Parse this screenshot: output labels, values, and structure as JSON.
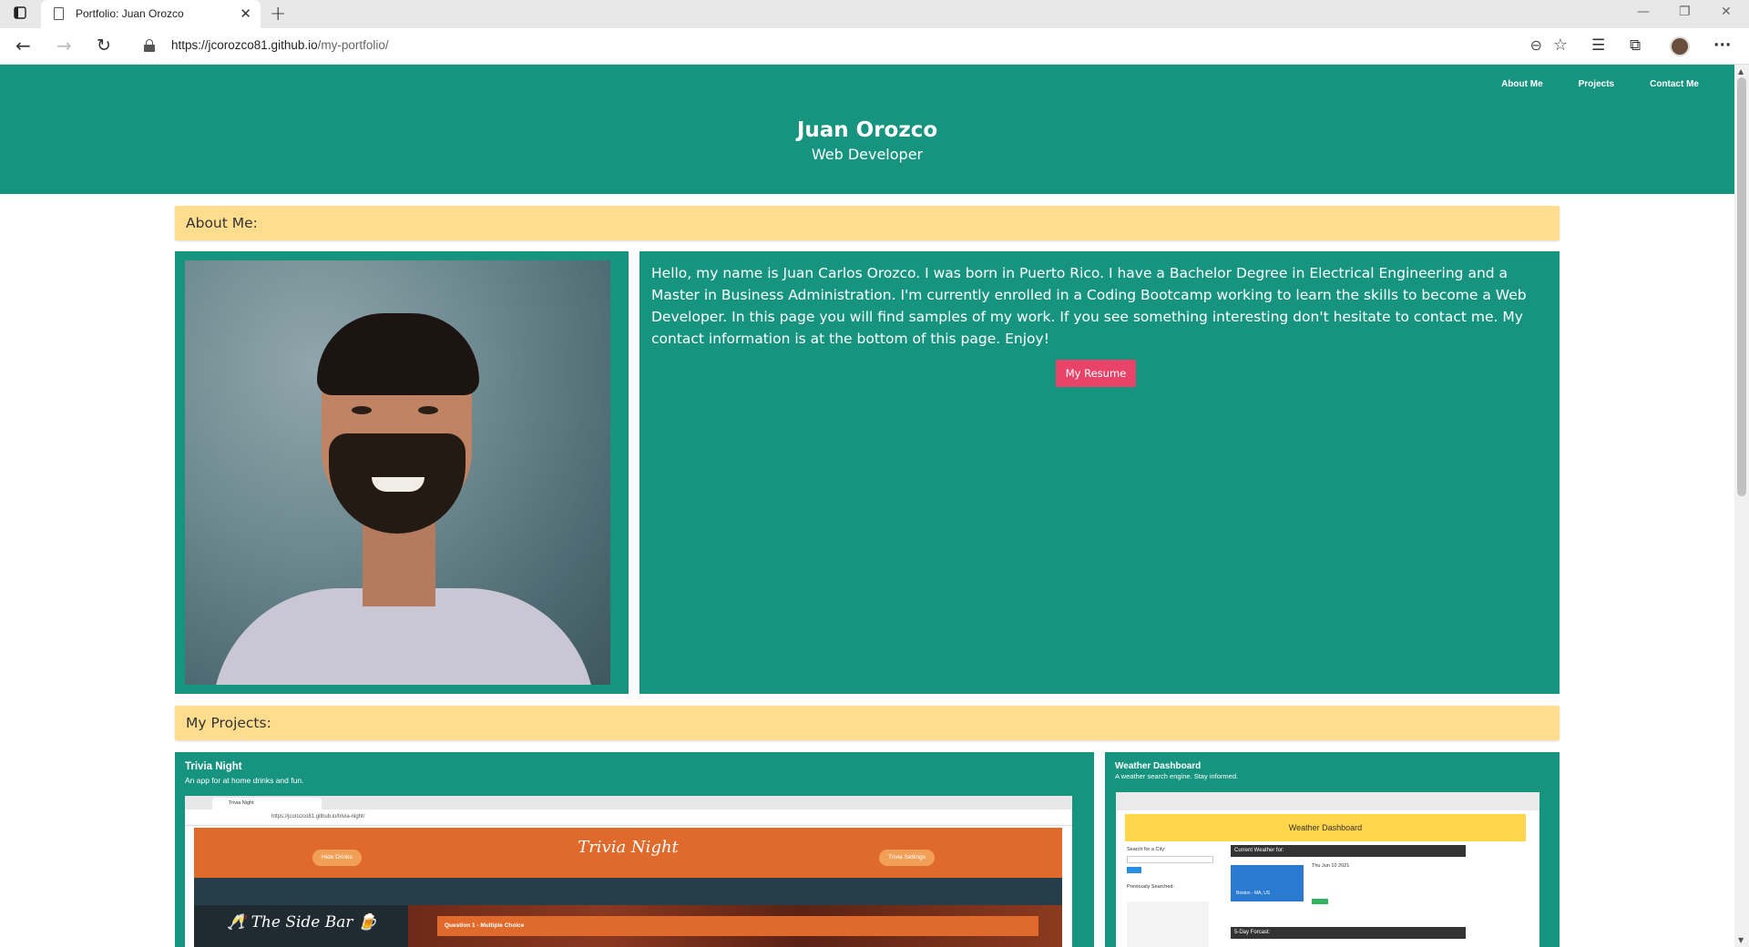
{
  "browser": {
    "tab_title": "Portfolio: Juan Orozco",
    "url_host": "https://jcorozco81.github.io",
    "url_path": "/my-portfolio/"
  },
  "header": {
    "name": "Juan Orozco",
    "role": "Web Developer",
    "nav": [
      "About Me",
      "Projects",
      "Contact Me"
    ]
  },
  "about": {
    "heading": "About Me:",
    "text": "Hello, my name is Juan Carlos Orozco. I was born in Puerto Rico. I have a Bachelor Degree in Electrical Engineering and a Master in Business Administration. I'm currently enrolled in a Coding Bootcamp working to learn the skills to become a Web Developer. In this page you will find samples of my work. If you see something interesting don't hesitate to contact me. My contact information is at the bottom of this page. Enjoy!",
    "resume_label": "My Resume"
  },
  "projects": {
    "heading": "My Projects:",
    "items": [
      {
        "title": "Trivia Night",
        "description": "An app for at home drinks and fun.",
        "shot": {
          "tab": "Trivia Night",
          "url": "https://jcorozco81.github.io/trivia-night/",
          "header": "Trivia Night",
          "left_button": "Hide Drinks",
          "right_button": "Trivia Settings",
          "sidebar": "🥂 The Side Bar 🍺",
          "question": "Question 1 - Multiple Choice"
        }
      },
      {
        "title": "Weather Dashboard",
        "description": "A weather search engine. Stay informed.",
        "shot": {
          "header": "Weather Dashboard",
          "search_label": "Search for a City:",
          "previous_label": "Previously Searched:",
          "current_label": "Current Weather for:",
          "city": "Boston - MA, US",
          "date": "Thu Jun 10 2021",
          "forecast_label": "5-Day Forcast:"
        }
      }
    ]
  },
  "colors": {
    "teal": "#179480",
    "yellow": "#ffdd8e",
    "resume_button": "#e8446a"
  }
}
